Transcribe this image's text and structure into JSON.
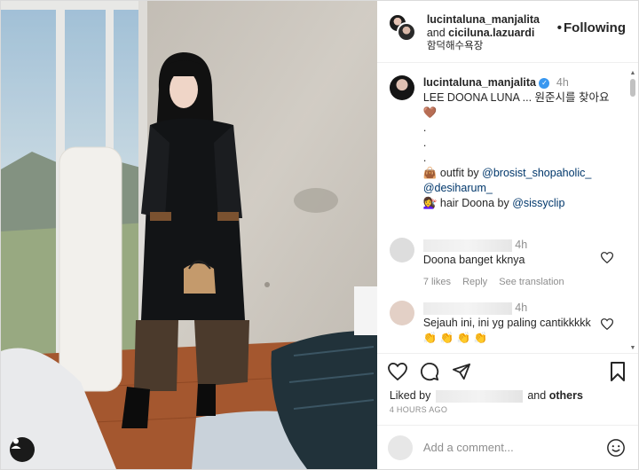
{
  "header": {
    "username": "lucintaluna_manjalita",
    "and_text": "and",
    "collaborator": "ciciluna.lazuardi",
    "location": "함덕해수욕장",
    "follow_label": "Following",
    "dot": "•"
  },
  "caption": {
    "username": "lucintaluna_manjalita",
    "time": "4h",
    "text": "LEE DOONA LUNA ... 원준시를 찾아요",
    "emoji_heart": "🤎",
    "dots": [
      ".",
      ".",
      "."
    ],
    "outfit_emoji": "👜",
    "outfit_label": "outfit by",
    "outfit_mention_1": "@brosist_shopaholic_",
    "outfit_mention_2": "@desiharum_",
    "hair_emoji": "💇‍♀️",
    "hair_label": "hair Doona by",
    "hair_mention": "@sissyclip"
  },
  "comments": [
    {
      "time": "4h",
      "text": "Doona banget kknya",
      "likes": "7 likes",
      "reply": "Reply",
      "translation": "See translation"
    },
    {
      "time": "4h",
      "text": "Sejauh ini, ini yg paling cantikkkkk",
      "emojis": "👏 👏 👏 👏"
    }
  ],
  "likes": {
    "prefix": "Liked by",
    "suffix": "and",
    "others": "others"
  },
  "timestamp": "4 HOURS AGO",
  "add_comment": {
    "placeholder": "Add a comment..."
  },
  "colors": {
    "link": "#00376b",
    "verified": "#3897f0",
    "muted": "#8e8e8e"
  }
}
